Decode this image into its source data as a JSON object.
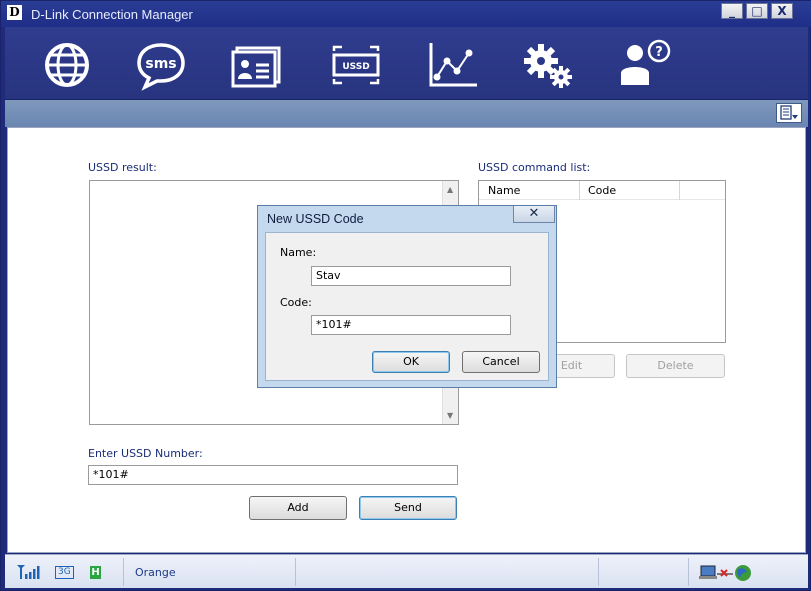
{
  "window": {
    "logo": "D",
    "title": "D-Link Connection Manager",
    "controls": [
      "_",
      "□",
      "X"
    ]
  },
  "toolbar": {
    "tools": [
      "globe-icon",
      "sms-icon",
      "contacts-icon",
      "ussd-icon",
      "statistics-icon",
      "settings-icon",
      "help-icon"
    ],
    "sms_label": "sms",
    "ussd_label": "USSD"
  },
  "ussd": {
    "result_label": "USSD result:",
    "command_list_label": "USSD command list:",
    "columns": [
      "Name",
      "Code"
    ],
    "enter_label": "Enter USSD Number:",
    "number_value": "*101#",
    "add_label": "Add",
    "send_label": "Send",
    "edit_label": "Edit",
    "delete_label": "Delete"
  },
  "dialog": {
    "title": "New USSD Code",
    "close_glyph": "✕",
    "name_label": "Name:",
    "name_value": "Stav",
    "code_label": "Code:",
    "code_value": "*101#",
    "ok_label": "OK",
    "cancel_label": "Cancel"
  },
  "status": {
    "network_type": "3G",
    "hspa_badge": "H",
    "operator": "Orange"
  },
  "colors": {
    "frame": "#1e2a7a",
    "toolbar": "#303c8e",
    "accent": "#1a2c78"
  }
}
